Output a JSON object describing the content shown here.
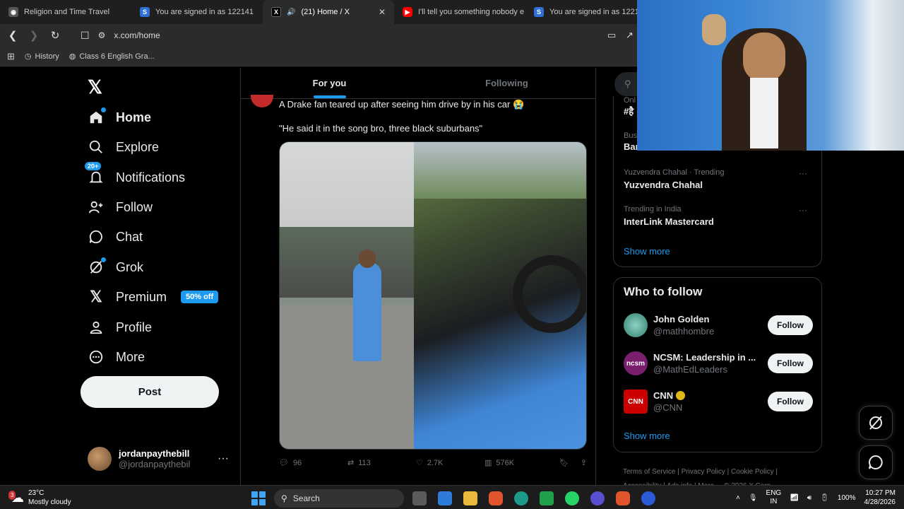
{
  "browser": {
    "tabs": [
      {
        "title": "Religion and Time Travel",
        "favicon_color": "#555555",
        "favicon_glyph": "◉"
      },
      {
        "title": "You are signed in as 122141",
        "favicon_color": "#2f6fd6",
        "favicon_glyph": "S"
      },
      {
        "title": "(21) Home / X",
        "favicon_color": "#000000",
        "favicon_glyph": "X",
        "active": true
      },
      {
        "title": "I'll tell you something nobody e",
        "favicon_color": "#ff0000",
        "favicon_glyph": "▶"
      },
      {
        "title": "You are signed in as 122141",
        "favicon_color": "#2f6fd6",
        "favicon_glyph": "S"
      }
    ],
    "url": "x.com/home",
    "bookmarks": [
      "History",
      "Class 6 English Gra..."
    ]
  },
  "nav": {
    "items": [
      {
        "label": "Home",
        "icon": "home-icon"
      },
      {
        "label": "Explore",
        "icon": "search-icon"
      },
      {
        "label": "Notifications",
        "icon": "bell-icon",
        "badge": "20+"
      },
      {
        "label": "Follow",
        "icon": "person-add-icon"
      },
      {
        "label": "Chat",
        "icon": "chat-icon"
      },
      {
        "label": "Grok",
        "icon": "grok-icon"
      },
      {
        "label": "Premium",
        "icon": "x-icon",
        "pill": "50% off"
      },
      {
        "label": "Profile",
        "icon": "profile-icon"
      },
      {
        "label": "More",
        "icon": "more-icon"
      }
    ],
    "post_label": "Post",
    "account": {
      "name": "jordanpaythebill",
      "handle": "@jordanpaythebil"
    }
  },
  "feed": {
    "tabs": [
      "For you",
      "Following"
    ],
    "tweet": {
      "text1": "A Drake fan teared up after seeing him drive by in his car 😭",
      "text2": "\"He said it in the song bro, three black suburbans\"",
      "replies": "96",
      "reposts": "113",
      "likes": "2.7K",
      "views": "576K"
    }
  },
  "right": {
    "search_placeholder": "S",
    "trends": [
      {
        "meta": "Yuzvendra Chahal · Trending",
        "name": "Yuzvendra Chahal"
      },
      {
        "meta": "Trending in India",
        "name": "InterLink Mastercard"
      }
    ],
    "partial_trends": [
      {
        "meta": "Onl",
        "name": "#है"
      },
      {
        "meta": "Bus",
        "name": "Bar"
      }
    ],
    "show_more": "Show more",
    "who_to_follow_title": "Who to follow",
    "who_to_follow": [
      {
        "name": "John Golden",
        "handle": "@mathhombre",
        "avatar_color": "#4aa38f",
        "avatar_text": ""
      },
      {
        "name": "NCSM: Leadership in ...",
        "handle": "@MathEdLeaders",
        "avatar_color": "#7a1f6e",
        "avatar_text": "ncsm"
      },
      {
        "name": "CNN",
        "handle": "@CNN",
        "avatar_color": "#cc0000",
        "avatar_text": "CNN",
        "verified": true
      }
    ],
    "follow_label": "Follow",
    "footer": [
      "Terms of Service",
      "Privacy Policy",
      "Cookie Policy",
      "Accessibility",
      "Ads info",
      "More ...",
      "© 2026 X Corp."
    ]
  },
  "taskbar": {
    "temperature": "23°C",
    "weather": "Mostly cloudy",
    "weather_badge": "3",
    "search": "Search",
    "lang1": "ENG",
    "lang2": "IN",
    "battery": "100%",
    "time": "10:27 PM",
    "date": "4/28/2026"
  }
}
